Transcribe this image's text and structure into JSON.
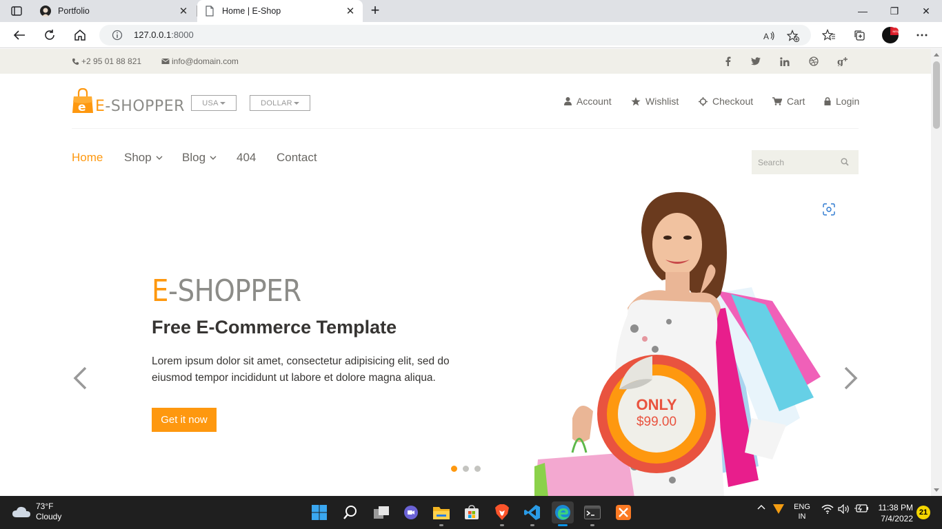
{
  "browser": {
    "tabs": [
      {
        "title": "Portfolio"
      },
      {
        "title": "Home | E-Shop"
      }
    ],
    "close_glyph": "✕",
    "new_tab_glyph": "+",
    "url_host": "127.0.0.1",
    "url_port": ":8000",
    "window_controls": {
      "minimize": "—",
      "restore": "❐",
      "close": "✕"
    }
  },
  "topbar": {
    "phone": "+2 95 01 88 821",
    "email": "info@domain.com",
    "social": [
      "f",
      "t",
      "in",
      "dribbble",
      "g+"
    ]
  },
  "header": {
    "logo_prefix": "E",
    "logo_rest": "-SHOPPER",
    "country": "USA",
    "currency": "DOLLAR",
    "links": [
      {
        "label": "Account",
        "icon": "user-icon"
      },
      {
        "label": "Wishlist",
        "icon": "star-icon"
      },
      {
        "label": "Checkout",
        "icon": "crosshairs-icon"
      },
      {
        "label": "Cart",
        "icon": "cart-icon"
      },
      {
        "label": "Login",
        "icon": "lock-icon"
      }
    ]
  },
  "nav": {
    "items": [
      {
        "label": "Home",
        "active": true
      },
      {
        "label": "Shop",
        "has_dropdown": true
      },
      {
        "label": "Blog",
        "has_dropdown": true
      },
      {
        "label": "404"
      },
      {
        "label": "Contact"
      }
    ],
    "search_placeholder": "Search"
  },
  "slider": {
    "brand_prefix": "E",
    "brand_rest": "-SHOPPER",
    "heading": "Free E-Commerce Template",
    "text": "Lorem ipsum dolor sit amet, consectetur adipisicing elit, sed do eiusmod tempor incididunt ut labore et dolore magna aliqua.",
    "button": "Get it now",
    "badge_only": "ONLY",
    "badge_price": "$99.00",
    "slide_count": 3,
    "active_slide": 1
  },
  "taskbar": {
    "weather_temp": "73°F",
    "weather_desc": "Cloudy",
    "lang_top": "ENG",
    "lang_bottom": "IN",
    "time": "11:38 PM",
    "date": "7/4/2022",
    "notifications": "21"
  },
  "colors": {
    "accent": "#fe980f",
    "text_dark": "#363432",
    "text_muted": "#696763",
    "topbar_bg": "#f0efe9",
    "badge_red": "#e9533f"
  }
}
